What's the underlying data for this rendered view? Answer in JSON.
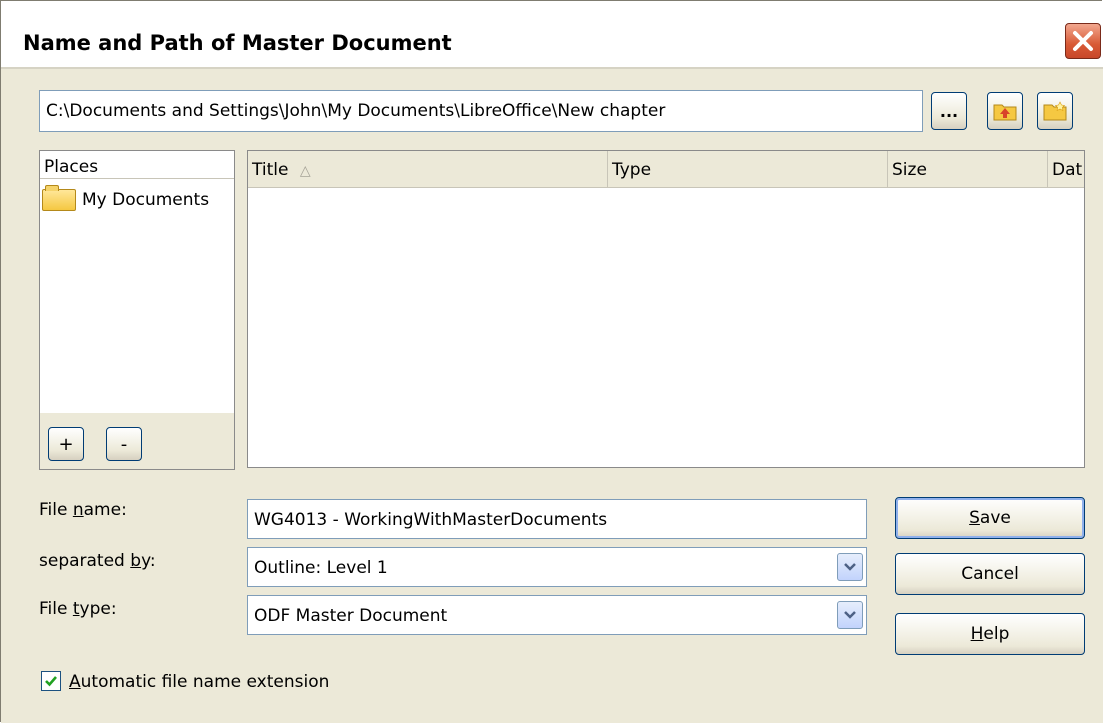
{
  "window": {
    "title": "Name and Path of Master Document"
  },
  "path": {
    "value": "C:\\Documents and Settings\\John\\My Documents\\LibreOffice\\New chapter"
  },
  "toolbar": {
    "browse_label": "..."
  },
  "places": {
    "header": "Places",
    "items": [
      {
        "label": "My Documents"
      }
    ],
    "add_label": "+",
    "remove_label": "-"
  },
  "files": {
    "columns": {
      "title": "Title",
      "sort_indicator": "△",
      "type": "Type",
      "size": "Size",
      "date": "Dat"
    }
  },
  "form": {
    "filename": {
      "pre": "File ",
      "accel": "n",
      "post": "ame:",
      "value": "WG4013 - WorkingWithMasterDocuments"
    },
    "separated": {
      "pre": "separated ",
      "accel": "b",
      "post": "y:",
      "value": "Outline: Level 1"
    },
    "filetype": {
      "pre": "File ",
      "accel": "t",
      "post": "ype:",
      "value": "ODF Master Document"
    }
  },
  "buttons": {
    "save": {
      "accel": "S",
      "rest": "ave"
    },
    "cancel": {
      "label": "Cancel"
    },
    "help": {
      "accel": "H",
      "rest": "elp"
    }
  },
  "options": {
    "auto_ext": {
      "accel": "A",
      "rest": "utomatic file name extension",
      "checked": true
    }
  },
  "colors": {
    "title_close": "#d85a36",
    "button_border": "#003c74",
    "field_border": "#7f9db9"
  }
}
